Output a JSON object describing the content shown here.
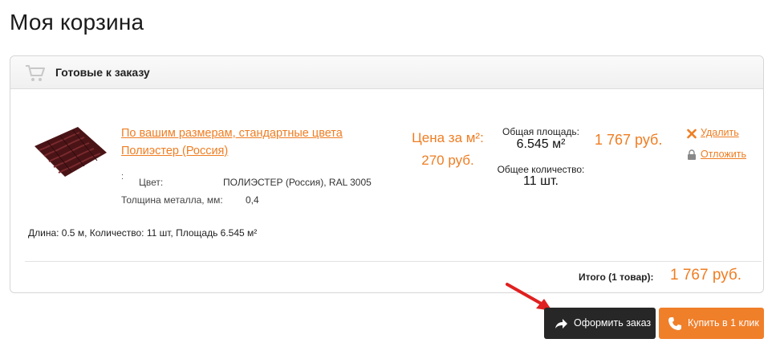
{
  "page": {
    "title": "Моя корзина"
  },
  "panel": {
    "title": "Готовые к заказу"
  },
  "product": {
    "name_line1": "По вашим размерам, стандартные цвета",
    "name_line2": "Полиэстер (Россия)",
    "colon": ":",
    "specs": [
      {
        "label": "Цвет:",
        "value": "ПОЛИЭСТЕР (Россия), RAL 3005"
      },
      {
        "label": "Толщина металла, мм:",
        "value": "0,4"
      }
    ],
    "price_label_line1": "Цена за м²:",
    "price_label_line2": "270 руб.",
    "area_label": "Общая площадь:",
    "area_value": "6.545 м²",
    "qty_label": "Общее количество:",
    "qty_value": "11 шт.",
    "line_total": "1 767 руб.",
    "dimensions": "Длина: 0.5 м, Количество: 11 шт, Площадь 6.545 м²",
    "image_color": "#5a1a1c"
  },
  "actions": {
    "delete": "Удалить",
    "postpone": "Отложить"
  },
  "summary": {
    "label": "Итого (1 товар):",
    "value": "1 767 руб."
  },
  "buttons": {
    "checkout": "Оформить заказ",
    "one_click": "Купить в 1 клик"
  },
  "colors": {
    "accent": "#ef7d22",
    "dark_button": "#272727",
    "annotation_arrow": "#e02020"
  }
}
